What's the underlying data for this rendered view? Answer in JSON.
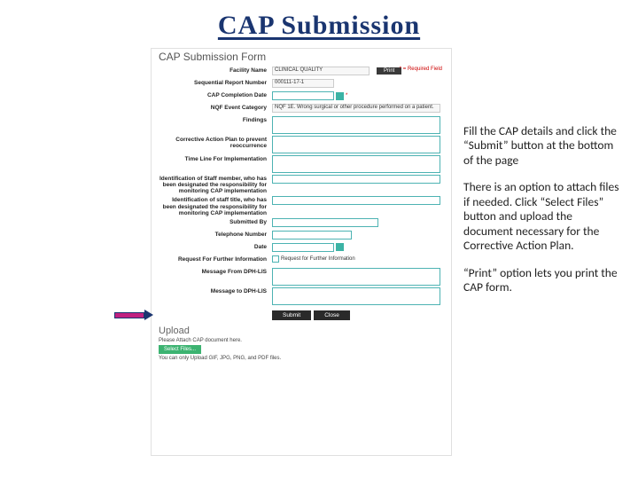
{
  "title": "CAP Submission",
  "form": {
    "heading": "CAP Submission Form",
    "required_note": "* = Required Field",
    "print_label": "Print",
    "labels": {
      "facility": "Facility Name",
      "seq": "Sequential Report Number",
      "completion": "CAP Completion Date",
      "nqf": "NQF Event Category",
      "findings": "Findings",
      "cap_plan": "Corrective Action Plan to prevent reoccurrence",
      "timeline": "Time Line For Implementation",
      "staff_member": "Identification of Staff member, who has been designated the responsibility for monitoring CAP implementation",
      "staff_title": "Identification of staff title, who has been designated the responsibility for monitoring CAP implementation",
      "submitted_by": "Submitted By",
      "telephone": "Telephone Number",
      "date": "Date",
      "req_info": "Request For Further Information",
      "msg_from": "Message From DPH-LIS",
      "msg_to": "Message to DPH-LIS"
    },
    "values": {
      "facility": "CLINICAL QUALITY",
      "seq": "000111-17-1",
      "nqf": "NQF 1E. Wrong surgical or other procedure performed on a patient.",
      "req_info_check": "Request for Further Information"
    },
    "buttons": {
      "submit": "Submit",
      "close": "Close"
    }
  },
  "upload": {
    "heading": "Upload",
    "instruction": "Please Attach CAP document here.",
    "select": "Select Files...",
    "note": "You can only Upload GIF, JPG, PNG, and PDF files."
  },
  "sidebar": {
    "p1": "Fill the CAP details and click the “Submit” button at the bottom of the page",
    "p2": "There is an option to attach files if needed. Click “Select Files” button and upload the document necessary for the Corrective Action Plan.",
    "p3": "“Print” option lets you print the CAP form."
  }
}
